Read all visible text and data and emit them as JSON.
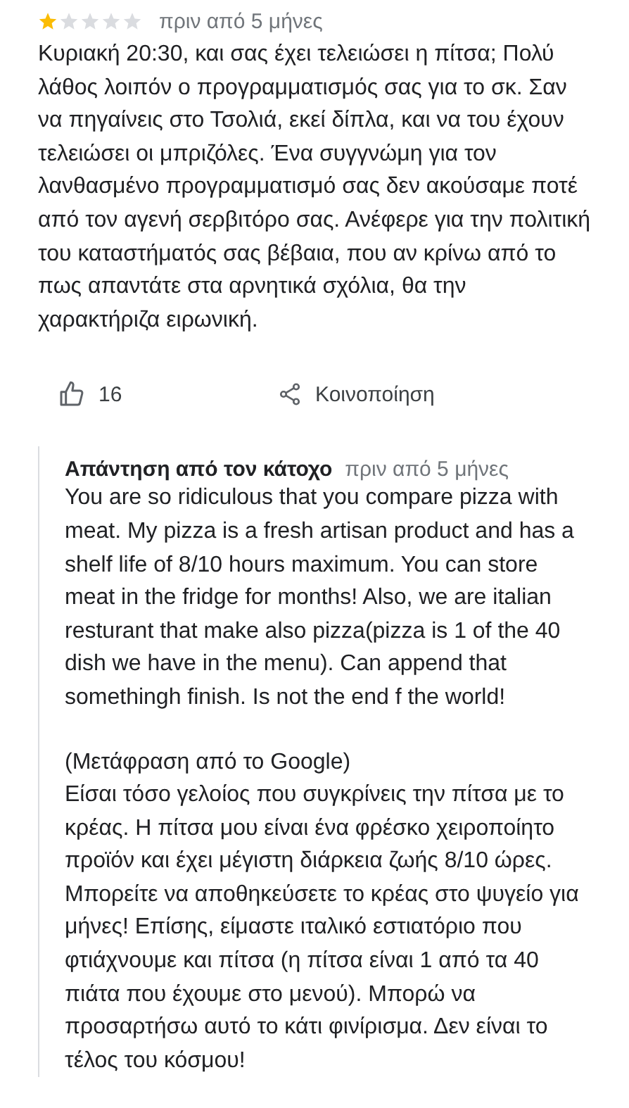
{
  "review": {
    "stars": 1,
    "time": "πριν από 5 μήνες",
    "text": "Κυριακή 20:30, και σας έχει τελειώσει η πίτσα; Πολύ λάθος λοιπόν ο προγραμματισμός σας για το σκ. Σαν να πηγαίνεις στο Τσολιά, εκεί δίπλα, και να του έχουν τελειώσει οι μπριζόλες. Ένα συγγνώμη για τον λανθασμένο προγραμματισμό σας δεν ακούσαμε ποτέ από τον αγενή σερβιτόρο σας. Ανέφερε για την πολιτική του καταστήματός σας βέβαια, που αν κρίνω από το πως απαντάτε στα αρνητικά σχόλια, θα την χαρακτήριζα ειρωνική."
  },
  "actions": {
    "likes": "16",
    "share": "Κοινοποίηση"
  },
  "owner_reply": {
    "author": "Απάντηση από τον κάτοχο",
    "time": "πριν από 5 μήνες",
    "text": "You are so ridiculous that you compare pizza with meat. My pizza is a fresh artisan product and has a shelf life of 8/10 hours maximum. You can store meat in the fridge for months! Also, we are italian resturant that make also pizza(pizza is 1 of the 40 dish we have in the menu). Can append that somethingh finish. Is not the end f the world!",
    "translation_label": "(Μετάφραση από το Google)",
    "translation": "Είσαι τόσο γελοίος που συγκρίνεις την πίτσα με το κρέας. Η πίτσα μου είναι ένα φρέσκο χειροποίητο προϊόν και έχει μέγιστη διάρκεια ζωής 8/10 ώρες. Μπορείτε να αποθηκεύσετε το κρέας στο ψυγείο για μήνες! Επίσης, είμαστε ιταλικό εστιατόριο που φτιάχνουμε και πίτσα (η πίτσα είναι 1 από τα 40 πιάτα που έχουμε στο μενού). Μπορώ να προσαρτήσω αυτό το κάτι φινίρισμα. Δεν είναι το τέλος του κόσμου!"
  }
}
